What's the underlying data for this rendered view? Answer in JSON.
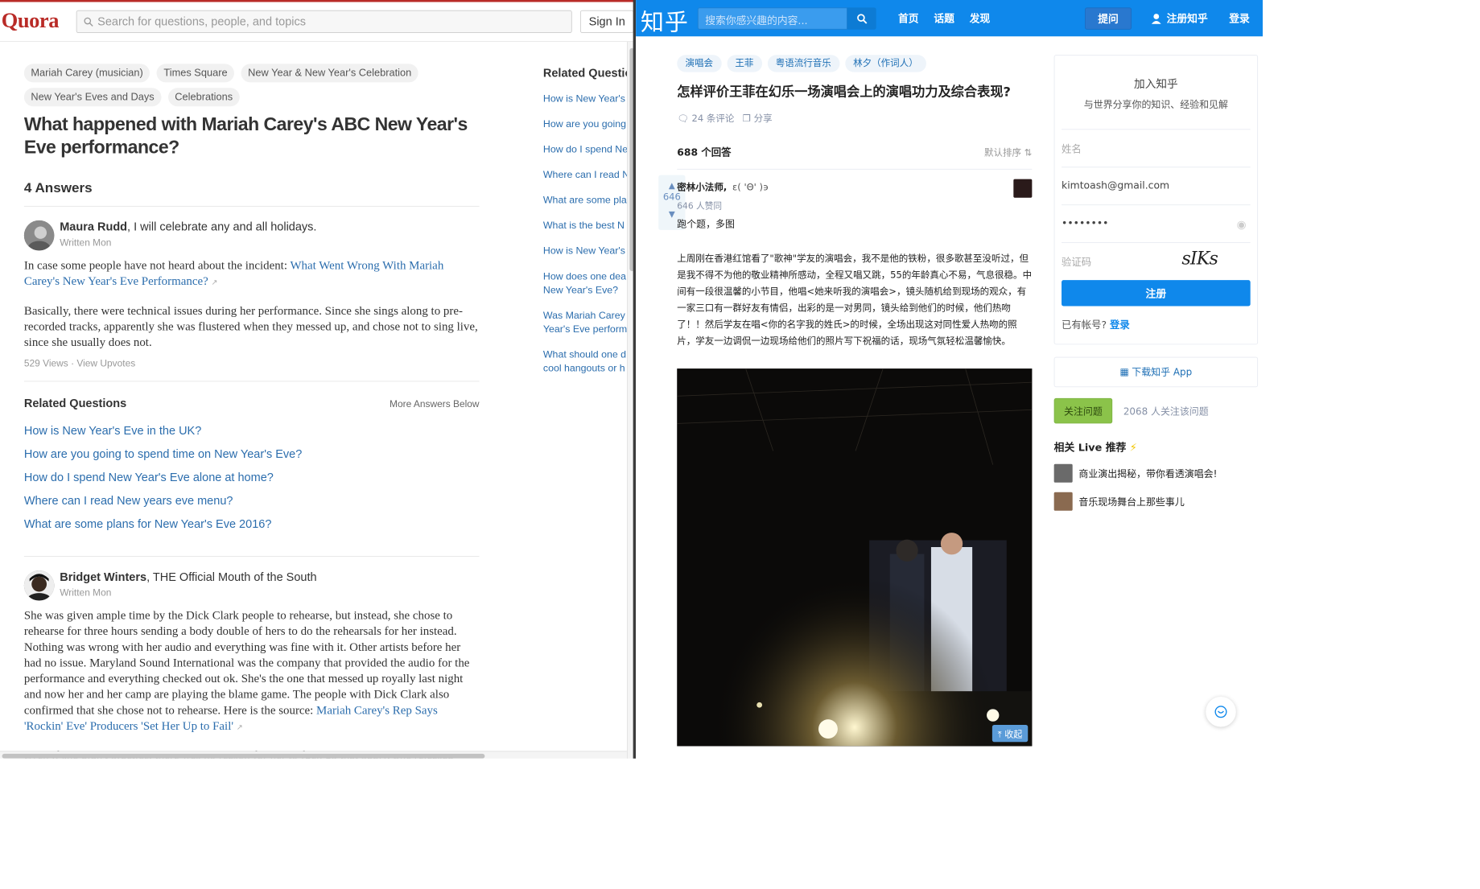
{
  "quora": {
    "logo": "Quora",
    "search_placeholder": "Search for questions, people, and topics",
    "sign_in": "Sign In",
    "tags": [
      "Mariah Carey (musician)",
      "Times Square",
      "New Year & New Year's Celebration",
      "New Year's Eves and Days",
      "Celebrations"
    ],
    "question_title": "What happened with Mariah Carey's ABC New Year's Eve performance?",
    "answers_count": "4 Answers",
    "answer1": {
      "author": "Maura Rudd",
      "credential": ", I will celebrate any and all holidays.",
      "written": "Written Mon",
      "p1_text": "In case some people have not heard about the incident: ",
      "p1_link": "What Went Wrong With Mariah Carey's New Year's Eve Performance?",
      "p2": "Basically, there were technical issues during her performance. Since she sings along to pre-recorded tracks, apparently she was flustered when they messed up, and chose not to sing live, since she usually does not.",
      "meta": "529 Views · View Upvotes"
    },
    "related": {
      "title": "Related Questions",
      "more": "More Answers Below",
      "items": [
        "How is New Year's Eve in the UK?",
        "How are you going to spend time on New Year's Eve?",
        "How do I spend New Year's Eve alone at home?",
        "Where can I read New years eve menu?",
        "What are some plans for New Year's Eve 2016?"
      ]
    },
    "answer2": {
      "author": "Bridget Winters",
      "credential": ", THE Official Mouth of the South",
      "written": "Written Mon",
      "p1_text": "She was given ample time by the Dick Clark people to rehearse, but instead, she chose to rehearse for three hours sending a body double of hers to do the rehearsals for her instead. Nothing was wrong with her audio and everything was fine with it. Other artists before her had no issue. Maryland Sound International was the company that provided the audio for the performance and everything checked out ok. She's the one that messed up royally last night and now her and her camp are playing the blame game. The people with Dick Clark also confirmed that she chose not to rehearse. Here is the source: ",
      "p1_link": "Mariah Carey's Rep Says 'Rockin' Eve' Producers 'Set Her Up to Fail'",
      "p2": "Even if she didn't practice, there was no reason for her to fuck up that badly. She released"
    },
    "side": {
      "title": "Related Questions",
      "items": [
        "How is New Year's",
        "How are you going",
        "How do I spend Ne",
        "Where can I read N",
        "What are some pla",
        "What is the best N",
        "How is New Year's",
        "How does one dea|New Year's Eve?",
        "Was Mariah Carey|Year's Eve perform",
        "What should one d|cool hangouts or h"
      ]
    }
  },
  "zhihu": {
    "logo": "知乎",
    "search_placeholder": "搜索你感兴趣的内容...",
    "nav": [
      "首页",
      "话题",
      "发现"
    ],
    "ask": "提问",
    "register": "注册知乎",
    "login": "登录",
    "topics": [
      "演唱会",
      "王菲",
      "粤语流行音乐",
      "林夕（作词人）"
    ],
    "question_title": "怎样评价王菲在幻乐一场演唱会上的演唱功力及综合表现?",
    "comments": "24 条评论",
    "share": "分享",
    "answers_count": "688 个回答",
    "sort": "默认排序",
    "vote_count": "646",
    "answer": {
      "author": "密林小法师,",
      "signature": "ε( 'Θ' )϶",
      "agree": "646 人赞同",
      "summary": "跑个题，多图",
      "text": "上周刚在香港红馆看了\"歌神\"学友的演唱会，我不是他的铁粉，很多歌甚至没听过，但是我不得不为他的敬业精神所感动，全程又唱又跳，55的年龄真心不易，气息很稳。中间有一段很温馨的小节目，他唱<她来听我的演唱会>，镜头随机给到现场的观众，有一家三口有一群好友有情侣，出彩的是一对男同，镜头给到他们的时候，他们热吻了！！然后学友在唱<你的名字我的姓氏>的时候，全场出现这对同性爱人热吻的照片，学友一边调侃一边现场给他们的照片写下祝福的话，现场气氛轻松温馨愉快。",
      "collapse": "收起"
    },
    "join": {
      "title": "加入知乎",
      "subtitle": "与世界分享你的知识、经验和见解",
      "name_placeholder": "姓名",
      "email": "kimtoash@gmail.com",
      "password": "••••••••",
      "captcha_placeholder": "验证码",
      "captcha": "sIKs",
      "submit": "注册",
      "have_account": "已有帐号?",
      "login": "登录"
    },
    "download": "下载知乎 App",
    "follow": "关注问题",
    "follow_count": "2068 人关注该问题",
    "live_title": "相关 Live 推荐",
    "lives": [
      "商业演出揭秘，带你看透演唱会!",
      "音乐现场舞台上那些事儿"
    ]
  }
}
